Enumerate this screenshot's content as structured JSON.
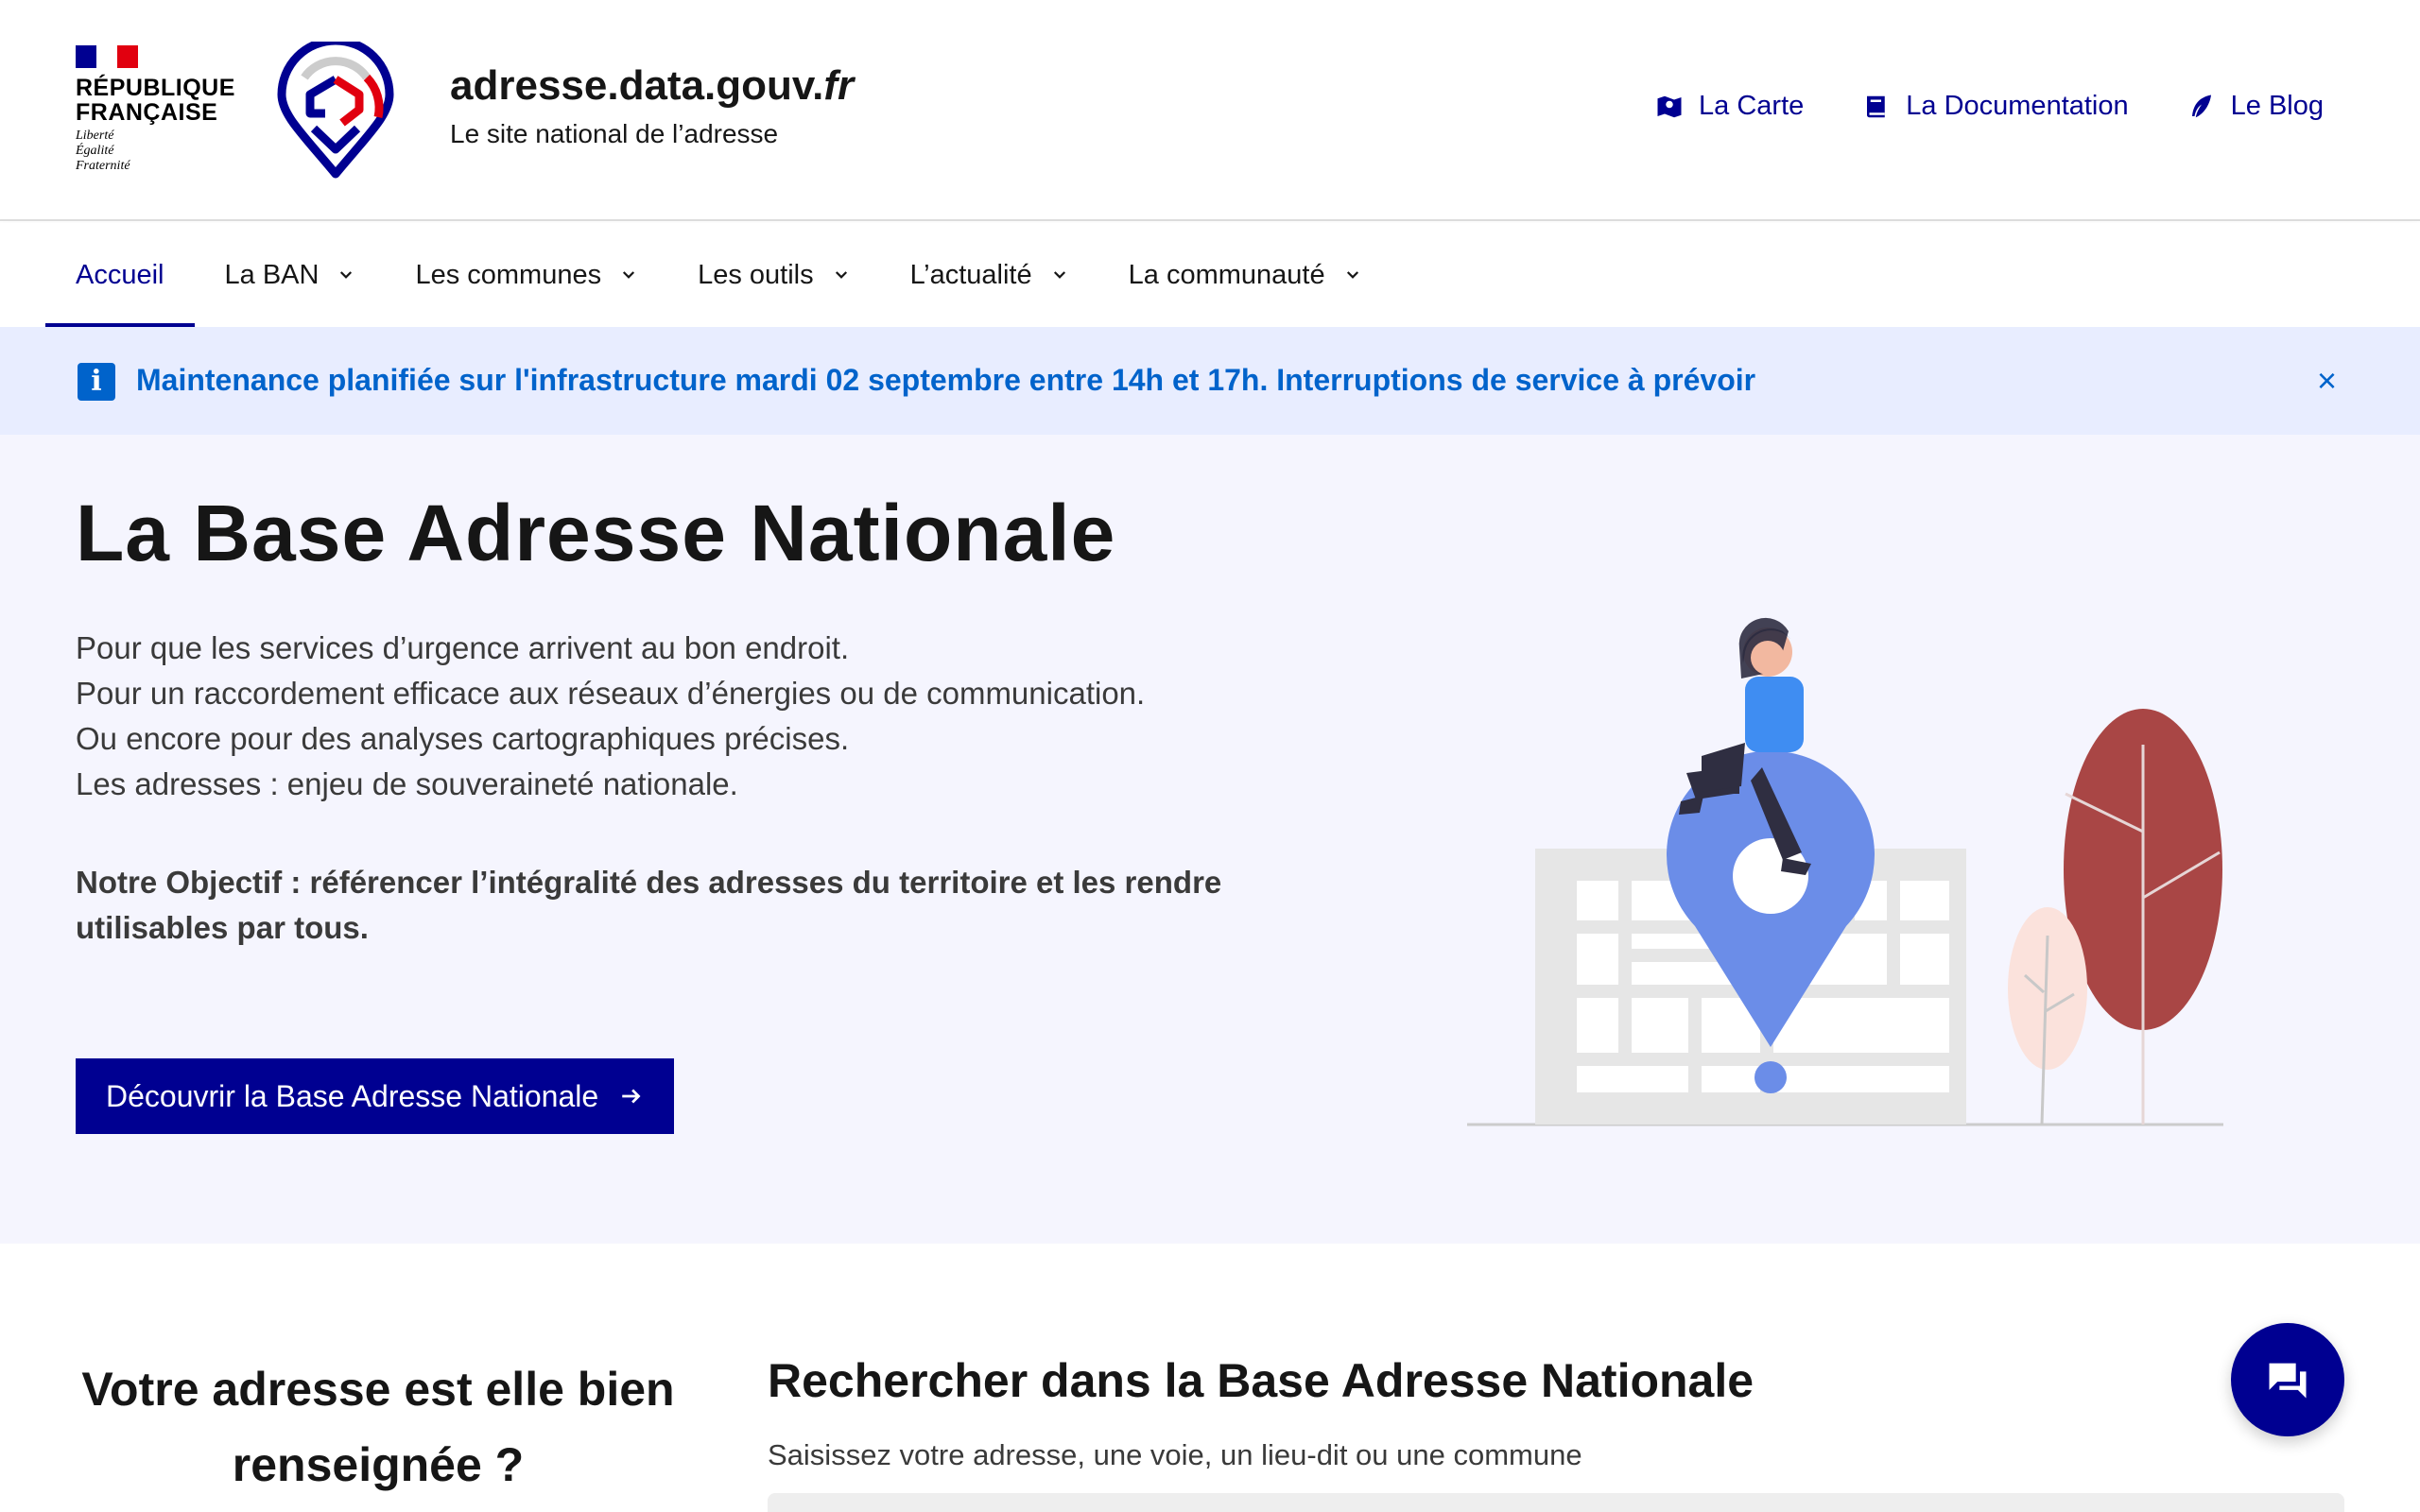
{
  "header": {
    "rf_name": "RÉPUBLIQUE\nFRANÇAISE",
    "rf_motto": "Liberté\nÉgalité\nFraternité",
    "site_title_main": "adresse.data.gouv.",
    "site_title_ext": "fr",
    "tagline": "Le site national de l’adresse",
    "tools": [
      {
        "label": "La Carte",
        "icon": "map-icon"
      },
      {
        "label": "La Documentation",
        "icon": "book-icon"
      },
      {
        "label": "Le Blog",
        "icon": "feather-icon"
      }
    ]
  },
  "nav": {
    "items": [
      {
        "label": "Accueil",
        "active": true
      },
      {
        "label": "La BAN"
      },
      {
        "label": "Les communes"
      },
      {
        "label": "Les outils"
      },
      {
        "label": "L’actualité"
      },
      {
        "label": "La communauté"
      }
    ]
  },
  "notice": {
    "text": "Maintenance planifiée sur l'infrastructure mardi 02 septembre entre 14h et 17h. Interruptions de service à prévoir",
    "close": "×"
  },
  "hero": {
    "title": "La Base Adresse Nationale",
    "lines": [
      "Pour que les services d’urgence arrivent au bon endroit.",
      "Pour un raccordement efficace aux réseaux d’énergies ou de communication.",
      "Ou encore pour des analyses cartographiques précises.",
      "Les adresses : enjeu de souveraineté nationale."
    ],
    "goal": "Notre Objectif : référencer l’intégralité des adresses du territoire et les rendre utilisables par tous.",
    "button": "Découvrir la Base Adresse Nationale"
  },
  "bottom": {
    "check_title": "Votre adresse est elle bien renseignée ?",
    "search_title": "Rechercher dans la Base Adresse Nationale",
    "search_sub": "Saisissez votre adresse, une voie, un lieu-dit ou une commune"
  },
  "colors": {
    "primary": "#000091",
    "info": "#0063cb",
    "hero_bg": "#f5f5fe",
    "notice_bg": "#e8edff"
  }
}
